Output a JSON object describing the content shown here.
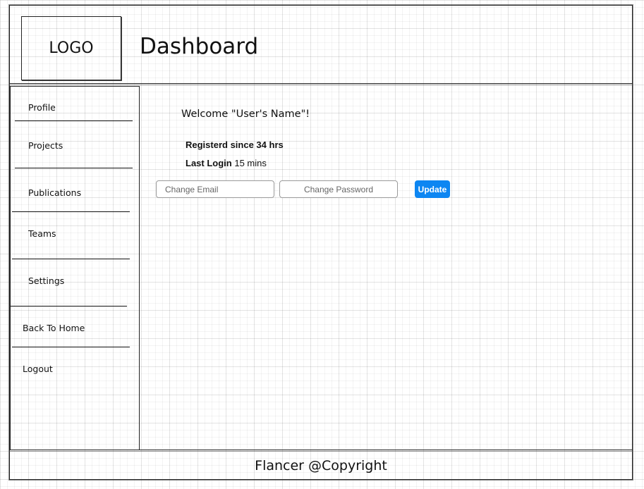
{
  "header": {
    "logo_text": "LOGO",
    "title": "Dashboard"
  },
  "sidebar": {
    "items": [
      {
        "label": "Profile"
      },
      {
        "label": "Projects"
      },
      {
        "label": "Publications"
      },
      {
        "label": "Teams"
      },
      {
        "label": "Settings"
      },
      {
        "label": "Back To Home"
      },
      {
        "label": "Logout"
      }
    ]
  },
  "main": {
    "welcome": "Welcome \"User's Name\"!",
    "registered_label": "Registerd since 34 hrs",
    "last_login_label": "Last Login",
    "last_login_value": "15 mins",
    "email_placeholder": "Change Email",
    "password_placeholder": "Change Password",
    "update_label": "Update",
    "accent_color": "#0d86f2"
  },
  "footer": {
    "text": "Flancer @Copyright"
  }
}
